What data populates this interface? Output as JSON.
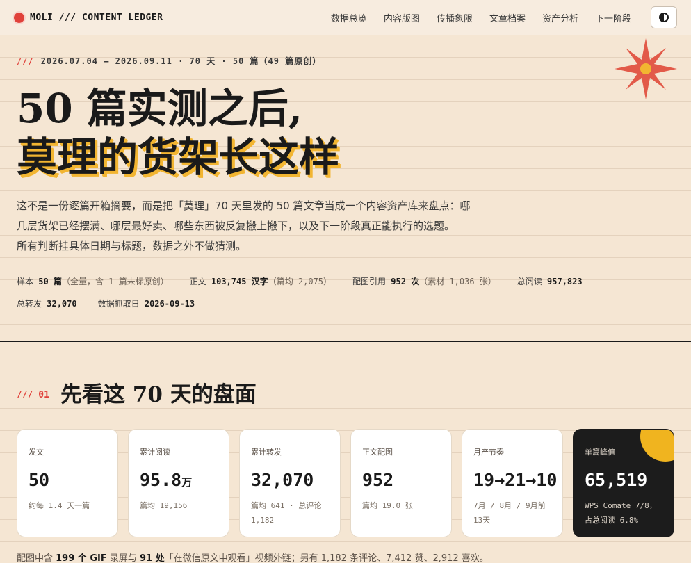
{
  "nav": {
    "brand": "MOLI /// CONTENT LEDGER",
    "links": [
      "数据总览",
      "内容版图",
      "传播象限",
      "文章档案",
      "资产分析",
      "下一阶段"
    ]
  },
  "hero": {
    "meta": {
      "slash": "///",
      "text": "2026.07.04 — 2026.09.11 · 70 天 · 50 篇（49 篇原创）"
    },
    "title_line1": "50 篇实测之后,",
    "title_line2": "莫理的货架长这样",
    "intro": [
      "这不是一份逐篇开箱摘要，而是把「莫理」70 天里发的 50 篇文章当成一个内容资产库来盘点：哪",
      "几层货架已经摆满、哪层最好卖、哪些东西被反复搬上搬下，以及下一阶段真正能执行的选题。",
      "所有判断挂具体日期与标题，数据之外不做猜测。"
    ],
    "stats": [
      {
        "label": "样本",
        "value": "50 篇",
        "note": "（全量，含 1 篇未标原创）"
      },
      {
        "label": "正文",
        "value": "103,745 汉字",
        "note": "（篇均 2,075）"
      },
      {
        "label": "配图引用",
        "value": "952 次",
        "note": "（素材 1,036 张）"
      },
      {
        "label": "总阅读",
        "value": "957,823",
        "note": ""
      },
      {
        "label": "总转发",
        "value": "32,070",
        "note": ""
      },
      {
        "label": "数据抓取日",
        "value": "2026-09-13",
        "note": ""
      }
    ]
  },
  "section1": {
    "num": "/// 01",
    "title": "先看这 70 天的盘面",
    "cards": [
      {
        "label": "发文",
        "value": "50",
        "unit": "",
        "sub": [
          "约每 1.4 天一篇"
        ]
      },
      {
        "label": "累计阅读",
        "value": "95.8",
        "unit": "万",
        "sub": [
          "篇均 19,156"
        ]
      },
      {
        "label": "累计转发",
        "value": "32,070",
        "unit": "",
        "sub": [
          "篇均 641 · 总评论",
          "1,182"
        ]
      },
      {
        "label": "正文配图",
        "value": "952",
        "unit": "",
        "sub": [
          "篇均 19.0 张"
        ]
      },
      {
        "label": "月产节奏",
        "value": "19→21→10",
        "unit": "",
        "sub": [
          "7月 / 8月 / 9月前",
          "13天"
        ]
      },
      {
        "label": "单篇峰值",
        "value": "65,519",
        "unit": "",
        "sub": [
          "WPS Comate 7/8，",
          "占总阅读 6.8%"
        ]
      }
    ],
    "footnote": {
      "p1": "配图中含 ",
      "b1": "199 个 GIF",
      "p2": " 录屏与 ",
      "b2": "91 处",
      "p3": "「在微信原文中观看」视频外链；另有 1,182 条评论、7,412 赞、2,912 喜欢。"
    }
  },
  "colors": {
    "accent": "#e0413a",
    "highlight": "#f2b531",
    "background": "#f5e6d3",
    "dark_card": "#1c1c1c"
  }
}
